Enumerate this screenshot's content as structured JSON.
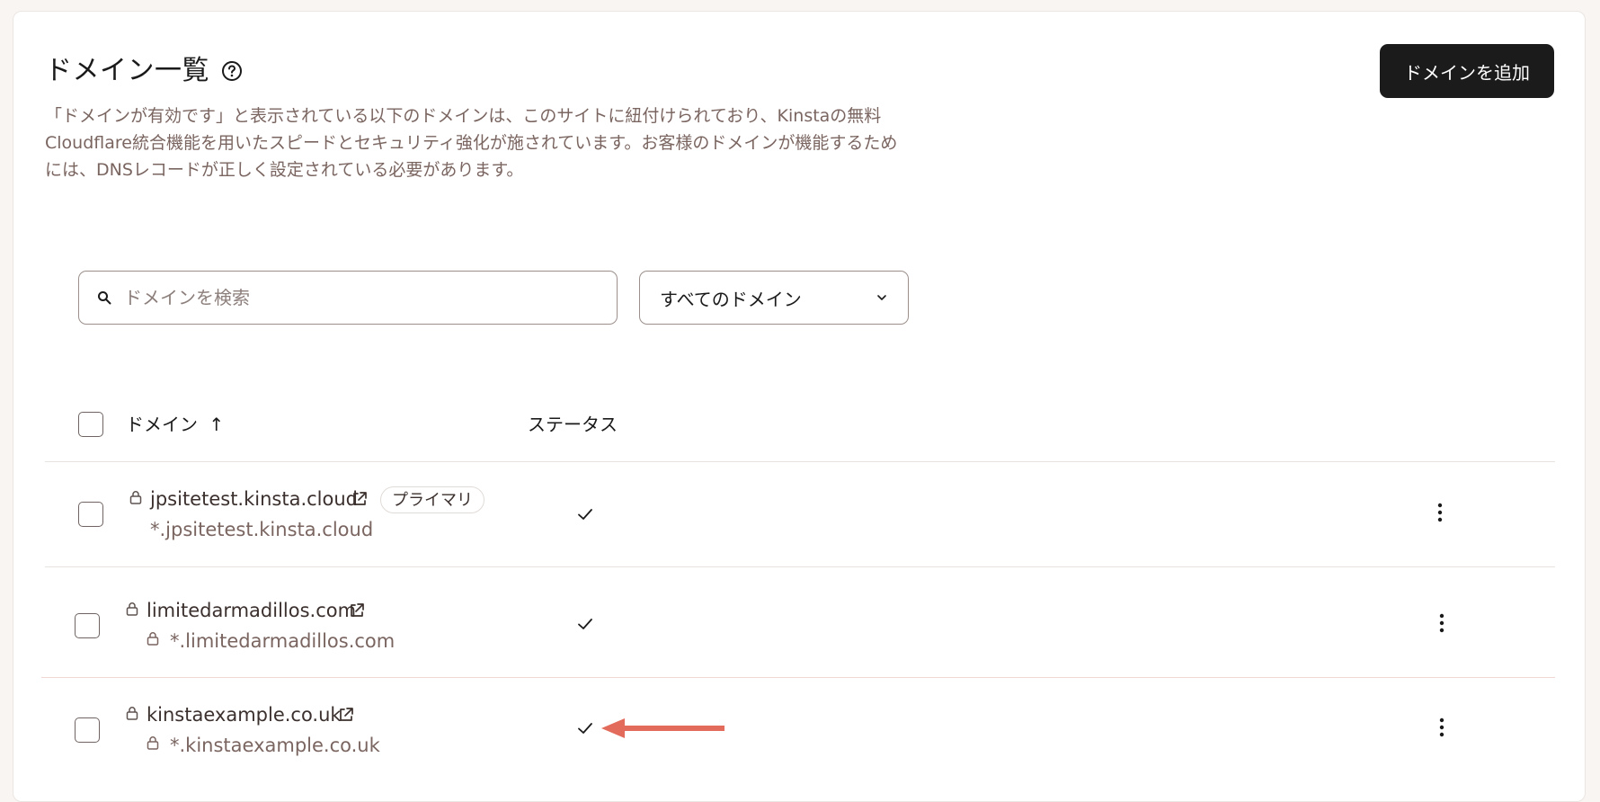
{
  "header": {
    "title": "ドメイン一覧",
    "description": "「ドメインが有効です」と表示されている以下のドメインは、このサイトに紐付けられており、Kinstaの無料Cloudflare統合機能を用いたスピードとセキュリティ強化が施されています。お客様のドメインが機能するためには、DNSレコードが正しく設定されている必要があります。",
    "add_button_label": "ドメインを追加"
  },
  "search": {
    "placeholder": "ドメインを検索",
    "value": ""
  },
  "filter": {
    "selected": "すべてのドメイン"
  },
  "table": {
    "columns": {
      "domain": "ドメイン",
      "status": "ステータス"
    },
    "sort_indicator": "↑",
    "rows": [
      {
        "domain": "jpsitetest.kinsta.cloud",
        "subdomain": "*.jpsitetest.kinsta.cloud",
        "badge": "プライマリ",
        "status": "active"
      },
      {
        "domain": "limitedarmadillos.com",
        "subdomain": "*.limitedarmadillos.com",
        "status": "active"
      },
      {
        "domain": "kinstaexample.co.uk",
        "subdomain": "*.kinstaexample.co.uk",
        "status": "active"
      }
    ]
  },
  "colors": {
    "accent_button": "#1b1b1b",
    "annotation_arrow": "#e36b5b",
    "muted_text": "#7a6560"
  },
  "icons": [
    "help-icon",
    "search-icon",
    "chevron-down-icon",
    "lock-icon",
    "external-link-icon",
    "check-icon",
    "kebab-menu-icon",
    "annotation-arrow"
  ]
}
